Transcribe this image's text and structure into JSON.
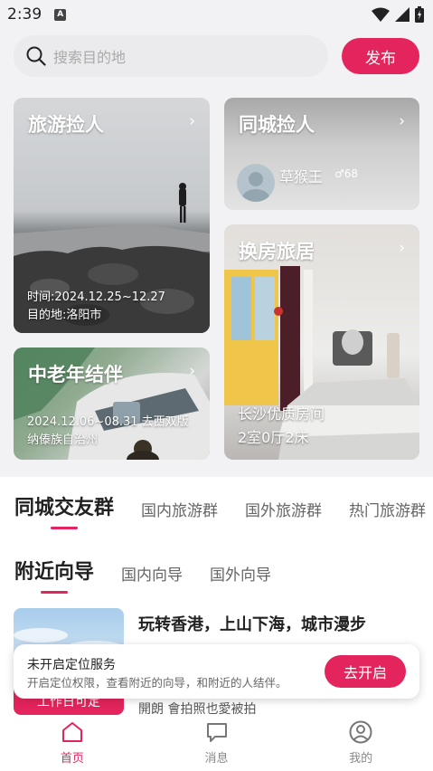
{
  "status": {
    "time": "2:39",
    "indicator": "A"
  },
  "search": {
    "placeholder": "搜索目的地",
    "publish_label": "发布"
  },
  "cards": {
    "travel": {
      "title": "旅游捡人",
      "time": "时间:2024.12.25~12.27",
      "destination": "目的地:洛阳市"
    },
    "local": {
      "title": "同城捡人",
      "user_name": "草猴王",
      "gender_symbol": "♂",
      "user_age": "68"
    },
    "house": {
      "title": "换房旅居",
      "desc1": "长沙优质房间",
      "desc2": "2室0厅2床"
    },
    "senior": {
      "title": "中老年结伴",
      "line1": "2024.12.06~08.31 去西双版",
      "line2": "纳傣族自治州"
    }
  },
  "group_tabs": [
    "同城交友群",
    "国内旅游群",
    "国外旅游群",
    "热门旅游群"
  ],
  "guide_tabs": [
    "附近向导",
    "国内向导",
    "国外向导"
  ],
  "guide": {
    "tag": "工作日可定",
    "title": "玩转香港，上山下海，城市漫步",
    "sub": "開朗 會拍照也愛被拍"
  },
  "toast": {
    "title": "未开启定位服务",
    "desc": "开启定位权限，查看附近的向导，和附近的人结伴。",
    "button": "去开启"
  },
  "nav": {
    "home": "首页",
    "messages": "消息",
    "profile": "我的"
  },
  "colors": {
    "accent": "#e4245c",
    "page_bg": "#f2f2f4"
  },
  "icons": [
    "search-icon",
    "chevron-right-icon",
    "home-icon",
    "message-icon",
    "user-icon",
    "wifi-icon",
    "signal-icon",
    "battery-icon"
  ]
}
